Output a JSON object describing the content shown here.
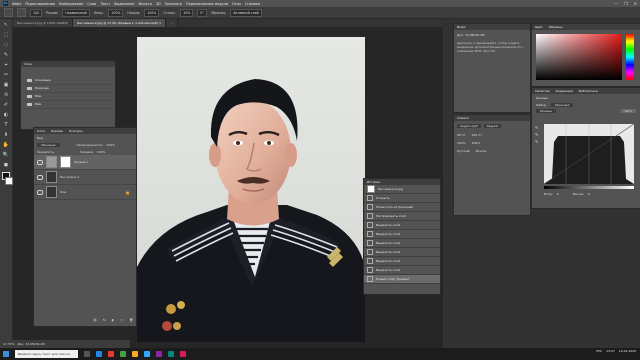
{
  "menubar": {
    "logo": "Ps",
    "items": [
      "Файл",
      "Редактирование",
      "Изображение",
      "Слои",
      "Текст",
      "Выделение",
      "Фильтр",
      "3D",
      "Просмотр",
      "Подключаемые модули",
      "Окно",
      "Справка"
    ],
    "window_controls": [
      "—",
      "❐",
      "✕"
    ]
  },
  "optbar": {
    "brush_size": "100",
    "mode_label": "Режим:",
    "mode_value": "Нормальный",
    "opacity_label": "Непр.:",
    "opacity_value": "100%",
    "flow_label": "Нажим:",
    "flow_value": "100%",
    "smoothing_label": "Сглаж.:",
    "smoothing_value": "10%",
    "angle_value": "0°",
    "sample_label": "Образец:",
    "sample_value": "Активный слой"
  },
  "tabs": [
    {
      "label": "Без имени-1.jpg @ 100% (RGB/8)",
      "active": false
    },
    {
      "label": "Без имени-2.jpg @ 17,4% (Кривые 1, Слой-маска/8) ×",
      "active": true
    },
    {
      "label": "...",
      "active": false
    }
  ],
  "tools": [
    "↖",
    "⬚",
    "◌",
    "✎",
    "⌖",
    "✂",
    "▣",
    "⟲",
    "✐",
    "◐",
    "T",
    "⬆",
    "✋",
    "🔍",
    "◼"
  ],
  "libraries_panel": {
    "title": "Слои",
    "folders": [
      "Основные",
      "Природа",
      "Мои",
      "Мои"
    ]
  },
  "layers_panel": {
    "tabs": [
      "Слои",
      "Каналы",
      "Контуры"
    ],
    "kind_label": "Вид",
    "blend_mode": "Обычные",
    "opacity_label": "Непрозрачность:",
    "opacity_value": "100%",
    "lock_label": "Закрепить:",
    "fill_label": "Заливка:",
    "fill_value": "100%",
    "layers": [
      {
        "name": "Кривые 1",
        "thumb": "white"
      },
      {
        "name": "Без имени-1",
        "thumb": "dark"
      },
      {
        "name": "Фон",
        "thumb": "dark"
      }
    ]
  },
  "history_panel": {
    "title": "История",
    "doc": "Без имени-2.jpg",
    "items": [
      "Открыть",
      "Поместить встроенный",
      "Растрировать слой",
      "Выделить слой",
      "Выделить слой",
      "Выделить слой",
      "Выделить слой",
      "Выделить слой",
      "Выделить слой",
      "Новый слой \"Кривые\""
    ]
  },
  "info_panel": {
    "title": "Инфо",
    "doc_label": "Док: 34,9М/36,4М",
    "description": "Щелкните и перемещайте, чтобы создать выделение. Дополнительные возможности с клавишами Shift, Alt и Ctrl."
  },
  "color_panel": {
    "tabs": [
      "Цвет",
      "Образцы"
    ]
  },
  "properties_panel": {
    "tabs": [
      "Свойства",
      "Коррекция",
      "Библиотеки"
    ],
    "section": "Кривые",
    "preset_label": "Набор:",
    "preset_value": "Заказная",
    "channel_value": "Кривые",
    "auto_label": "Авто",
    "output_label": "Выход:",
    "input_label": "Вход:",
    "input_value": "0",
    "output_value": "0"
  },
  "symbol_panel": {
    "title": "Символ",
    "font_family": "Segoe Light",
    "font_style": "Regular",
    "size": "48 пт",
    "tracking": "100 пт",
    "scale_v": "100%",
    "scale_h": "100%",
    "language": "Русский",
    "aa": "Резкое"
  },
  "statusbar": {
    "zoom": "17,37%",
    "doc": "Док: 34,9M/36,4M"
  },
  "taskbar": {
    "search_text": "Введите здесь текст для поиска",
    "time": "13:27",
    "date": "14.01.2020",
    "lang": "РУС"
  },
  "colors": {
    "workspace": "#282828",
    "panel": "#535353",
    "accent": "#31a8ff",
    "uniform": "#15171c",
    "collar_stripe": "#dfe3e8"
  }
}
